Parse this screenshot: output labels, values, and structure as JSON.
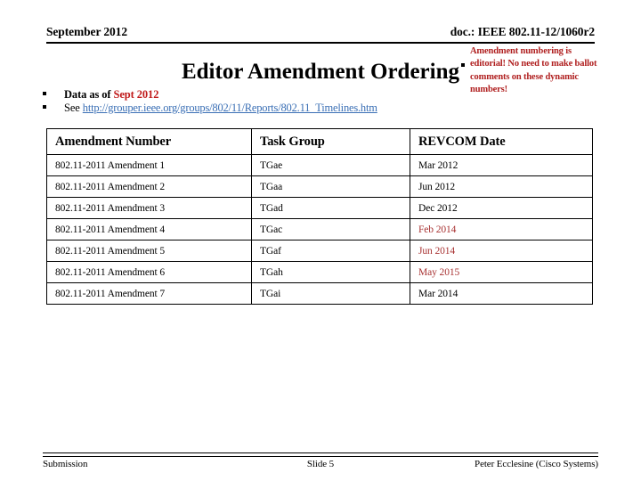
{
  "header": {
    "date": "September 2012",
    "doc_ref": "doc.: IEEE 802.11-12/1060r2"
  },
  "title": "Editor Amendment Ordering",
  "callout": {
    "text": "Amendment numbering is editorial! No need to make ballot comments on these dynamic numbers!",
    "color": "#B02020"
  },
  "bullets": {
    "item1_prefix": "Data as of ",
    "item1_emphasis": "Sept 2012",
    "item1_emphasis_color": "#C01A1A",
    "item2_prefix": "See ",
    "item2_link": "http://grouper.ieee.org/groups/802/11/Reports/802.11_Timelines.htm",
    "link_color": "#3A6FB5"
  },
  "table": {
    "columns": [
      "Amendment Number",
      "Task Group",
      "REVCOM Date"
    ],
    "date_highlight_color": "#A83232",
    "rows": [
      {
        "amendment": "802.11-2011 Amendment 1",
        "task_group": "TGae",
        "revcom_date": "Mar 2012",
        "date_red": false
      },
      {
        "amendment": "802.11-2011 Amendment 2",
        "task_group": "TGaa",
        "revcom_date": "Jun 2012",
        "date_red": false
      },
      {
        "amendment": "802.11-2011 Amendment 3",
        "task_group": "TGad",
        "revcom_date": "Dec 2012",
        "date_red": false
      },
      {
        "amendment": "802.11-2011 Amendment 4",
        "task_group": "TGac",
        "revcom_date": "Feb 2014",
        "date_red": true
      },
      {
        "amendment": "802.11-2011 Amendment 5",
        "task_group": "TGaf",
        "revcom_date": "Jun 2014",
        "date_red": true
      },
      {
        "amendment": "802.11-2011 Amendment 6",
        "task_group": "TGah",
        "revcom_date": "May 2015",
        "date_red": true
      },
      {
        "amendment": "802.11-2011 Amendment 7",
        "task_group": "TGai",
        "revcom_date": "Mar 2014",
        "date_red": false
      }
    ]
  },
  "footer": {
    "left": "Submission",
    "center": "Slide 5",
    "right": "Peter Ecclesine (Cisco Systems)"
  }
}
